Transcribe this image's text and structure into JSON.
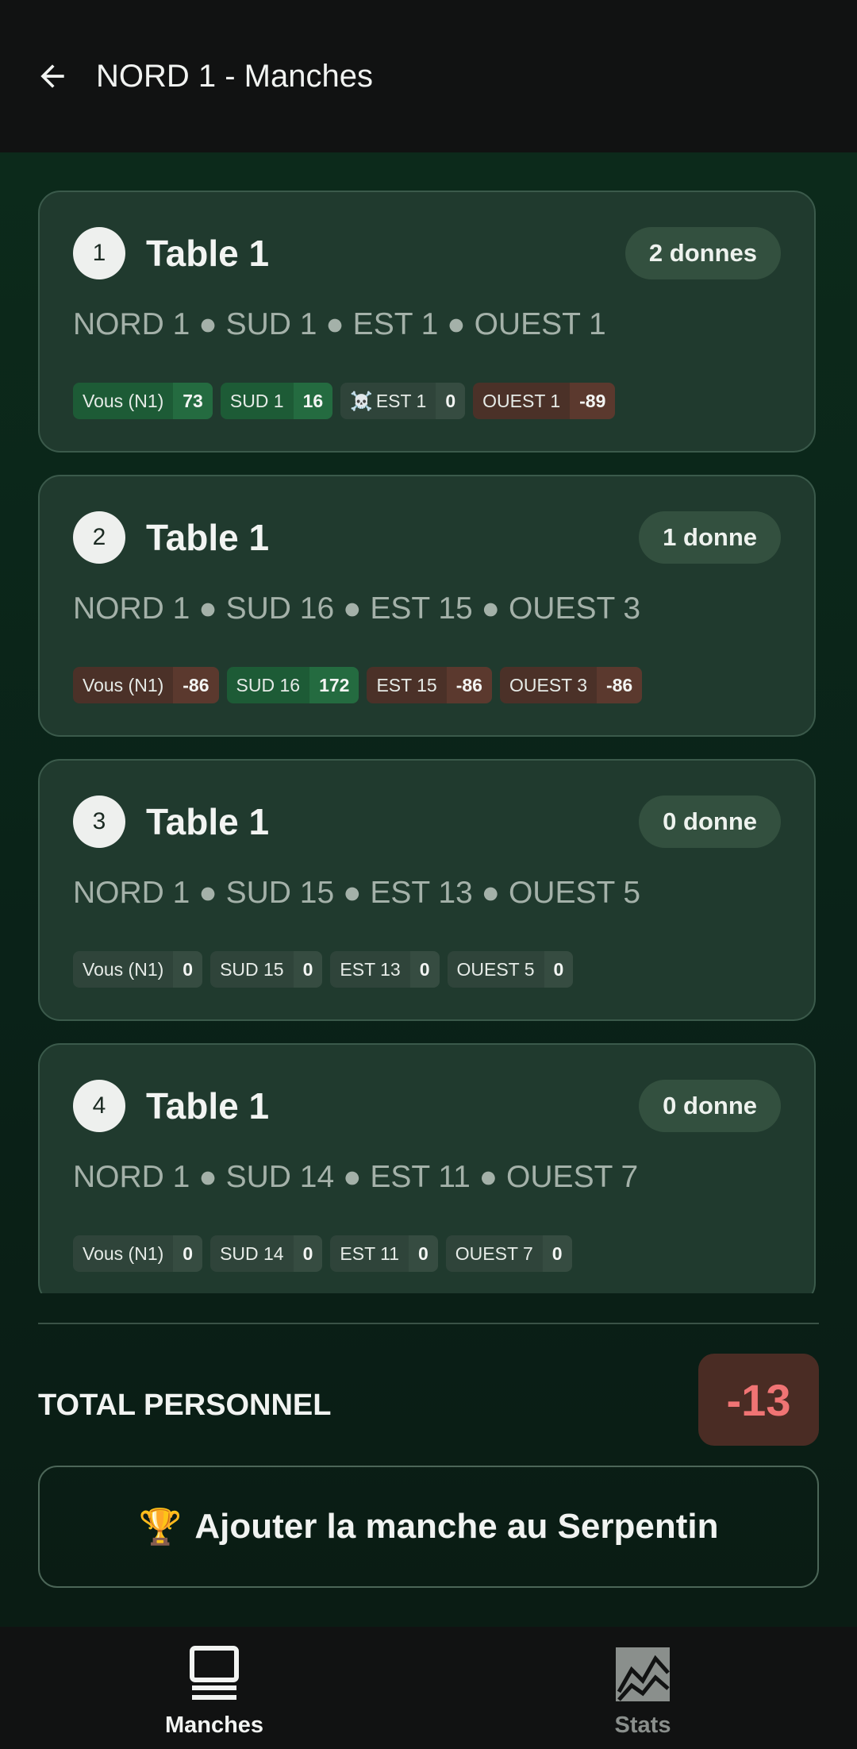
{
  "header": {
    "title": "NORD 1 - Manches"
  },
  "cards": [
    {
      "number": "1",
      "title": "Table 1",
      "donnes": "2 donnes",
      "players": "NORD 1 ● SUD 1 ● EST 1 ● OUEST 1",
      "scores": [
        {
          "name": "Vous (N1)",
          "value": "73",
          "status": "pos"
        },
        {
          "name": "SUD 1",
          "value": "16",
          "status": "pos"
        },
        {
          "name": "EST 1",
          "value": "0",
          "status": "neu",
          "icon": "☠️"
        },
        {
          "name": "OUEST 1",
          "value": "-89",
          "status": "neg"
        }
      ]
    },
    {
      "number": "2",
      "title": "Table 1",
      "donnes": "1 donne",
      "players": "NORD 1 ● SUD 16 ● EST 15 ● OUEST 3",
      "scores": [
        {
          "name": "Vous (N1)",
          "value": "-86",
          "status": "neg"
        },
        {
          "name": "SUD 16",
          "value": "172",
          "status": "pos"
        },
        {
          "name": "EST 15",
          "value": "-86",
          "status": "neg"
        },
        {
          "name": "OUEST 3",
          "value": "-86",
          "status": "neg"
        }
      ]
    },
    {
      "number": "3",
      "title": "Table 1",
      "donnes": "0 donne",
      "players": "NORD 1 ● SUD 15 ● EST 13 ● OUEST 5",
      "scores": [
        {
          "name": "Vous (N1)",
          "value": "0",
          "status": "neu"
        },
        {
          "name": "SUD 15",
          "value": "0",
          "status": "neu"
        },
        {
          "name": "EST 13",
          "value": "0",
          "status": "neu"
        },
        {
          "name": "OUEST 5",
          "value": "0",
          "status": "neu"
        }
      ]
    },
    {
      "number": "4",
      "title": "Table 1",
      "donnes": "0 donne",
      "players": "NORD 1 ● SUD 14 ● EST 11 ● OUEST 7",
      "scores": [
        {
          "name": "Vous (N1)",
          "value": "0",
          "status": "neu"
        },
        {
          "name": "SUD 14",
          "value": "0",
          "status": "neu"
        },
        {
          "name": "EST 11",
          "value": "0",
          "status": "neu"
        },
        {
          "name": "OUEST 7",
          "value": "0",
          "status": "neu"
        }
      ]
    }
  ],
  "total": {
    "label": "TOTAL PERSONNEL",
    "value": "-13"
  },
  "add_button": {
    "icon": "🏆",
    "label": "Ajouter la manche au Serpentin"
  },
  "nav": [
    {
      "label": "Manches",
      "icon": "table-icon",
      "active": true
    },
    {
      "label": "Stats",
      "icon": "chart-icon",
      "active": false
    }
  ],
  "colors": {
    "positive": "#1d5b36",
    "negative": "#4b3128",
    "neutral": "#2f443a",
    "total_negative": "#f07474",
    "nav_active": "#f2f4f2",
    "nav_inactive": "#8a8f8c"
  }
}
